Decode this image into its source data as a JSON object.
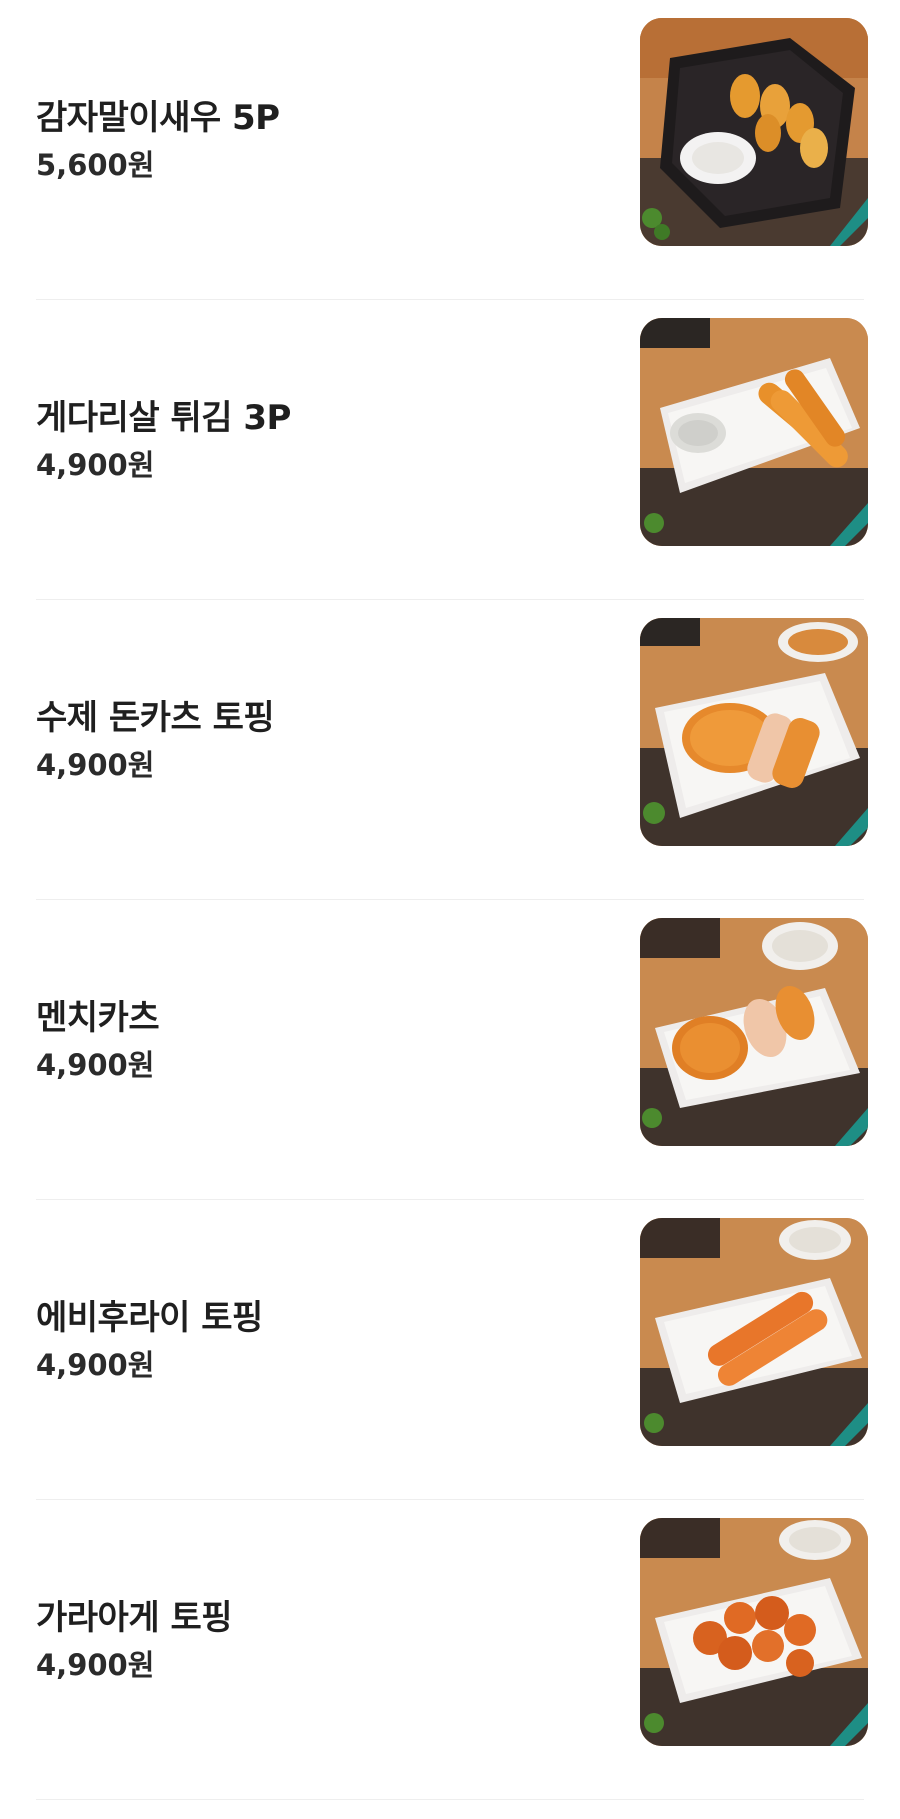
{
  "menu": {
    "items": [
      {
        "name": "감자말이새우 5P",
        "price": "5,600원",
        "image": "potato-wrapped-shrimp-photo"
      },
      {
        "name": "게다리살 튀김 3P",
        "price": "4,900원",
        "image": "fried-crab-stick-photo"
      },
      {
        "name": "수제 돈카츠 토핑",
        "price": "4,900원",
        "image": "handmade-tonkatsu-photo"
      },
      {
        "name": "멘치카츠",
        "price": "4,900원",
        "image": "menchi-katsu-photo"
      },
      {
        "name": "에비후라이 토핑",
        "price": "4,900원",
        "image": "ebi-fry-photo"
      },
      {
        "name": "가라아게 토핑",
        "price": "4,900원",
        "image": "karaage-photo"
      }
    ]
  }
}
